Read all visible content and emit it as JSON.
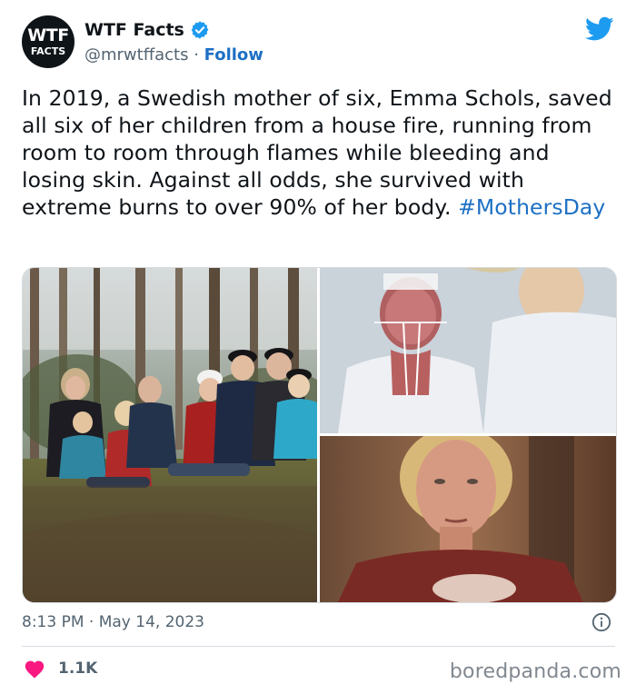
{
  "author": {
    "avatar_line1": "WTF",
    "avatar_line2": "FACTS",
    "name": "WTF Facts",
    "handle": "@mrwtffacts",
    "separator": " · ",
    "follow_label": "Follow"
  },
  "tweet": {
    "text": "In 2019, a Swedish mother of six, Emma Schols, saved all six of her children from a house fire, running from room to room through flames while bleeding and losing skin. Against all odds, she survived with extreme burns to over 90% of her body. ",
    "hashtag": "#MothersDay",
    "time": "8:13 PM",
    "date_separator": " · ",
    "date": "May 14, 2023"
  },
  "engagement": {
    "likes": "1.1K"
  },
  "watermark": "boredpanda.com",
  "icons": {
    "verified": "verified-badge-icon",
    "platform": "twitter-bird-icon",
    "info": "info-icon",
    "like": "heart-icon"
  },
  "colors": {
    "link": "#1d70c4",
    "verified": "#1d9bf0",
    "heart": "#f91880",
    "muted": "#536471"
  }
}
